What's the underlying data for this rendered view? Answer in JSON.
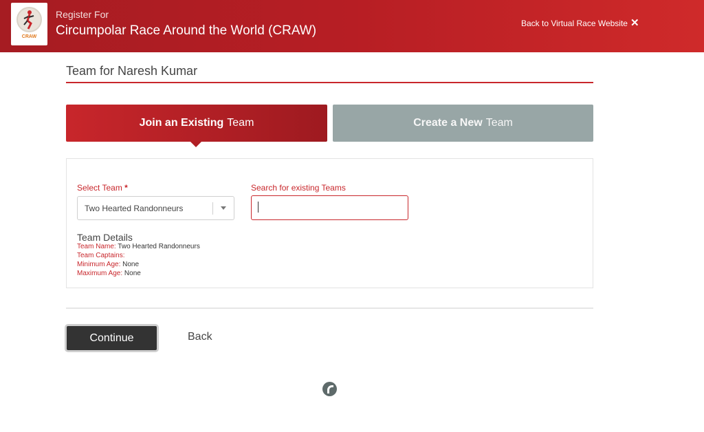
{
  "header": {
    "register_label": "Register For",
    "race_title": "Circumpolar Race Around the World (CRAW)",
    "back_link_label": "Back to Virtual Race Website",
    "logo_text": "CRAW",
    "close_icon": "close-icon"
  },
  "page": {
    "heading": "Team for Naresh Kumar"
  },
  "tabs": {
    "join": {
      "bold": "Join an Existing",
      "rest": "Team",
      "active": true
    },
    "create": {
      "bold": "Create a New",
      "rest": "Team",
      "active": false
    }
  },
  "form": {
    "select_team_label": "Select Team",
    "required_marker": "*",
    "selected_team": "Two Hearted Randonneurs",
    "search_label": "Search for existing Teams",
    "search_value": "",
    "search_placeholder": ""
  },
  "team_details": {
    "title": "Team Details",
    "rows": [
      {
        "key": "Team Name:",
        "value": "Two Hearted Randonneurs"
      },
      {
        "key": "Team Captains:",
        "value": ""
      },
      {
        "key": "Minimum Age:",
        "value": "None"
      },
      {
        "key": "Maximum Age:",
        "value": "None"
      }
    ]
  },
  "actions": {
    "continue_label": "Continue",
    "back_label": "Back"
  },
  "colors": {
    "accent": "#c8262b",
    "header_dark": "#a61c22",
    "inactive_tab": "#98a6a6",
    "button_dark": "#333333"
  }
}
